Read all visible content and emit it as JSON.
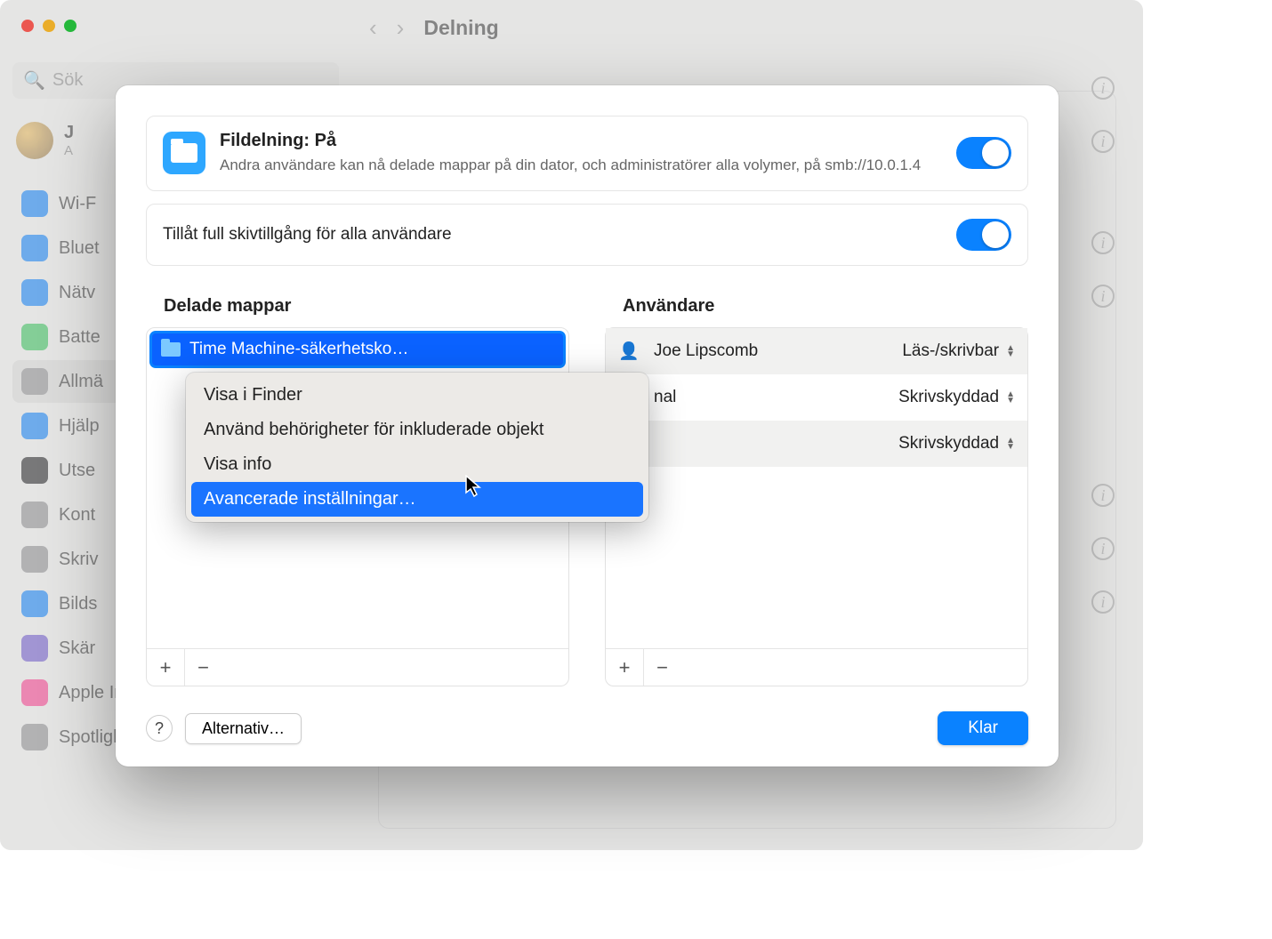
{
  "bg": {
    "title": "Delning",
    "search_placeholder": "Sök",
    "user_initial": "J",
    "user_sub": "A",
    "sidebar": [
      {
        "label": "Wi-F",
        "color": "#0a82ff"
      },
      {
        "label": "Bluet",
        "color": "#0a82ff"
      },
      {
        "label": "Nätv",
        "color": "#0a82ff"
      },
      {
        "label": "Batte",
        "color": "#34c759"
      },
      {
        "label": "Allmä",
        "color": "#8e8e93",
        "selected": true
      },
      {
        "label": "Hjälp",
        "color": "#0a82ff"
      },
      {
        "label": "Utse",
        "color": "#1c1c1e"
      },
      {
        "label": "Kont",
        "color": "#8e8e93"
      },
      {
        "label": "Skriv",
        "color": "#8e8e93"
      },
      {
        "label": "Bilds",
        "color": "#0a82ff"
      },
      {
        "label": "Skär",
        "color": "#6e56cf"
      },
      {
        "label": "Apple Intelligence och Siri",
        "color": "#ff3b8e"
      },
      {
        "label": "Spotlight",
        "color": "#8e8e93"
      }
    ]
  },
  "modal": {
    "file_sharing_title": "Fildelning: På",
    "file_sharing_sub": "Andra användare kan nå delade mappar på din dator, och administratörer alla volymer, på smb://10.0.1.4",
    "full_disk_label": "Tillåt full skivtillgång för alla användare",
    "shared_header": "Delade mappar",
    "users_header": "Användare",
    "folder_name": "Time Machine-säkerhetsko…",
    "users": [
      {
        "name": "Joe Lipscomb",
        "perm": "Läs-/skrivbar",
        "alt": true
      },
      {
        "name": "nal",
        "perm": "Skrivskyddad",
        "alt": false
      },
      {
        "name": "",
        "perm": "Skrivskyddad",
        "alt": true
      }
    ],
    "context_menu": [
      {
        "label": "Visa i Finder"
      },
      {
        "label": "Använd behörigheter för inkluderade objekt"
      },
      {
        "label": "Visa info"
      },
      {
        "label": "Avancerade inställningar…",
        "selected": true
      }
    ],
    "plus": "+",
    "minus": "−",
    "help": "?",
    "options": "Alternativ…",
    "done": "Klar"
  }
}
